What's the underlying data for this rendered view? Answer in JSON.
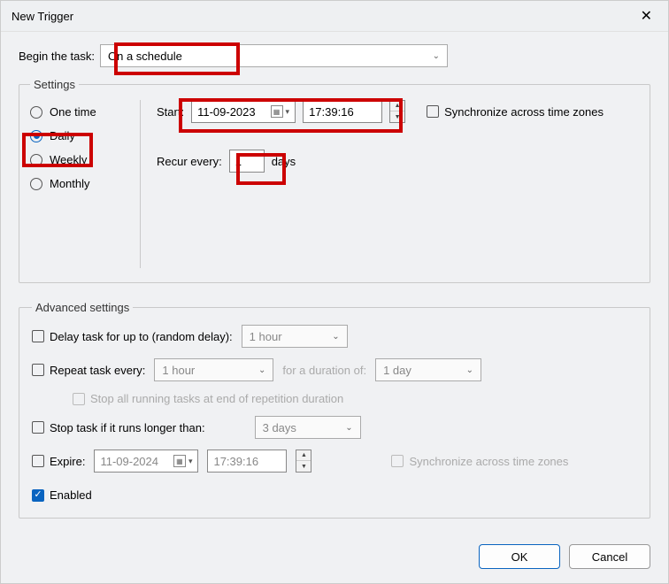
{
  "title": "New Trigger",
  "begin": {
    "label": "Begin the task:",
    "value": "On a schedule"
  },
  "settings": {
    "legend": "Settings",
    "radios": {
      "onetime": "One time",
      "daily": "Daily",
      "weekly": "Weekly",
      "monthly": "Monthly"
    },
    "start_label": "Start:",
    "start_date": "11-09-2023",
    "start_time": "17:39:16",
    "sync_tz": "Synchronize across time zones",
    "recur_label": "Recur every:",
    "recur_value": "1",
    "recur_unit": "days"
  },
  "advanced": {
    "legend": "Advanced settings",
    "delay_label": "Delay task for up to (random delay):",
    "delay_value": "1 hour",
    "repeat_label": "Repeat task every:",
    "repeat_value": "1 hour",
    "duration_label": "for a duration of:",
    "duration_value": "1 day",
    "stopall_label": "Stop all running tasks at end of repetition duration",
    "stoplong_label": "Stop task if it runs longer than:",
    "stoplong_value": "3 days",
    "expire_label": "Expire:",
    "expire_date": "11-09-2024",
    "expire_time": "17:39:16",
    "sync_tz2": "Synchronize across time zones",
    "enabled_label": "Enabled"
  },
  "buttons": {
    "ok": "OK",
    "cancel": "Cancel"
  }
}
